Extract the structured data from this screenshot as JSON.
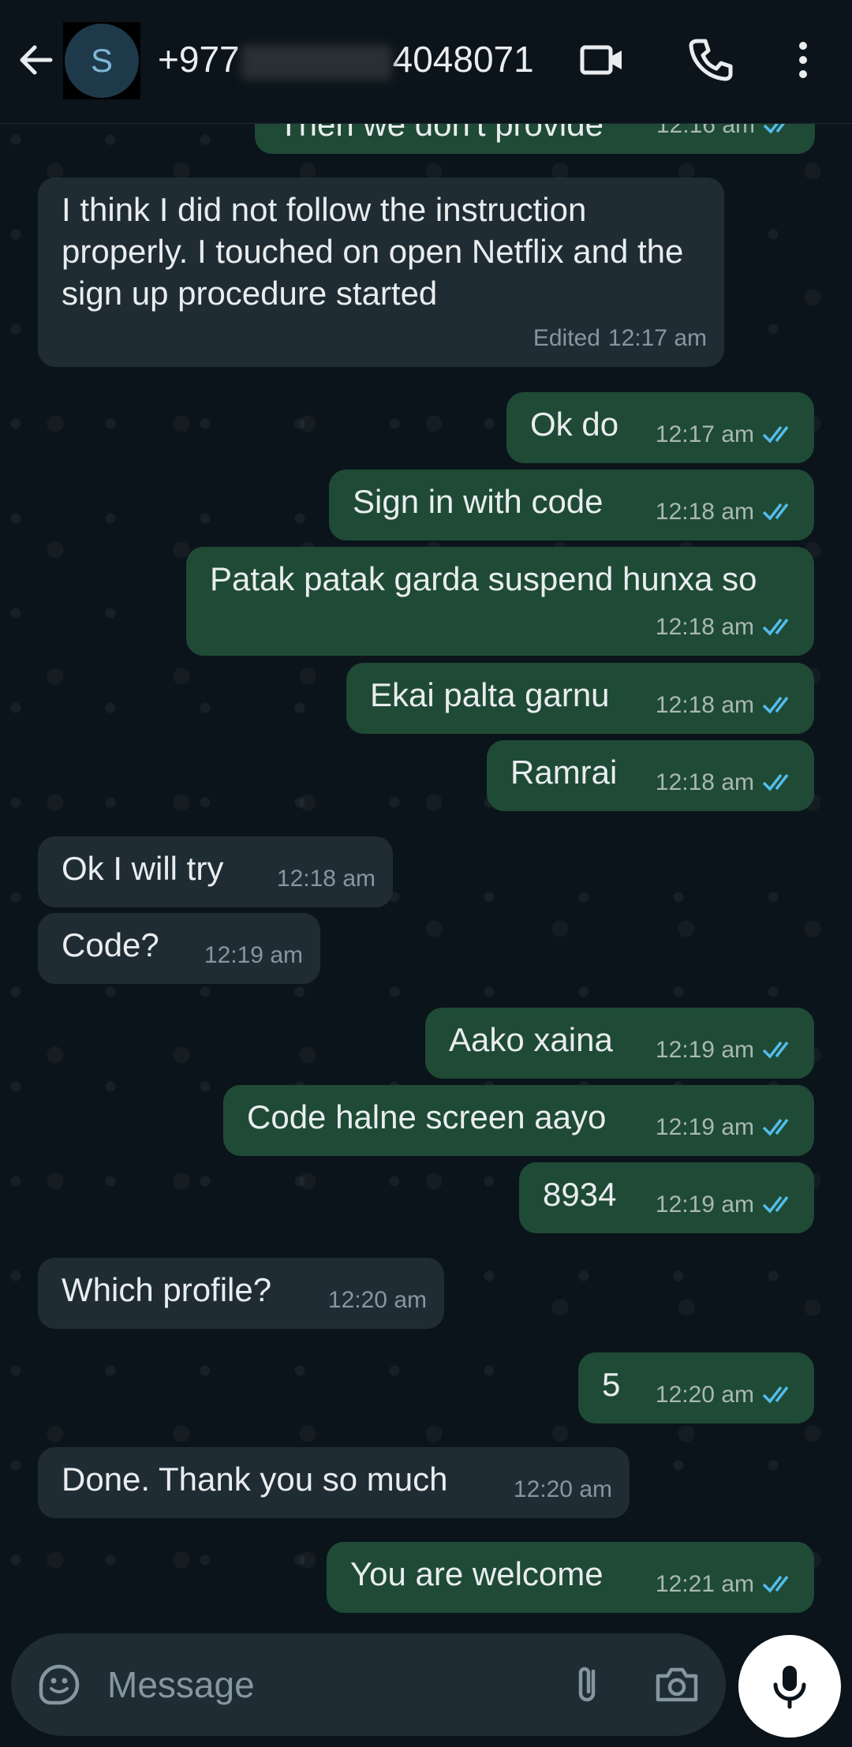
{
  "header": {
    "avatar_letter": "S",
    "contact_prefix": "+977",
    "contact_suffix": "4048071"
  },
  "icons": {
    "back": "arrow-left-icon",
    "video": "video-call-icon",
    "call": "phone-icon",
    "menu": "more-vertical-icon",
    "emoji": "sticker-icon",
    "attach": "paperclip-icon",
    "camera": "camera-icon",
    "mic": "mic-icon"
  },
  "messages": [
    {
      "dir": "out",
      "text": "Then we don't provide",
      "time": "12:16 am"
    },
    {
      "dir": "in",
      "text": "I think I did not follow the instruction properly. I touched on open Netflix and the sign up procedure started",
      "time": "12:17 am",
      "edited": "Edited"
    },
    {
      "dir": "out",
      "text": "Ok do",
      "time": "12:17 am"
    },
    {
      "dir": "out",
      "text": "Sign in with code",
      "time": "12:18 am"
    },
    {
      "dir": "out",
      "text": "Patak patak garda suspend hunxa so",
      "time": "12:18 am"
    },
    {
      "dir": "out",
      "text": "Ekai palta garnu",
      "time": "12:18 am"
    },
    {
      "dir": "out",
      "text": "Ramrai",
      "time": "12:18 am"
    },
    {
      "dir": "in",
      "text": "Ok I will try",
      "time": "12:18 am"
    },
    {
      "dir": "in",
      "text": "Code?",
      "time": "12:19 am"
    },
    {
      "dir": "out",
      "text": "Aako xaina",
      "time": "12:19 am"
    },
    {
      "dir": "out",
      "text": "Code halne screen aayo",
      "time": "12:19 am"
    },
    {
      "dir": "out",
      "text": "8934",
      "time": "12:19 am"
    },
    {
      "dir": "in",
      "text": "Which profile?",
      "time": "12:20 am"
    },
    {
      "dir": "out",
      "text": "5",
      "time": "12:20 am"
    },
    {
      "dir": "in",
      "text": "Done. Thank you so much",
      "time": "12:20 am"
    },
    {
      "dir": "out",
      "text": "You are welcome",
      "time": "12:21 am"
    }
  ],
  "composer": {
    "placeholder": "Message"
  },
  "colors": {
    "outgoing": "#1f4a36",
    "incoming": "#202c33",
    "read_ticks": "#53bdeb"
  }
}
